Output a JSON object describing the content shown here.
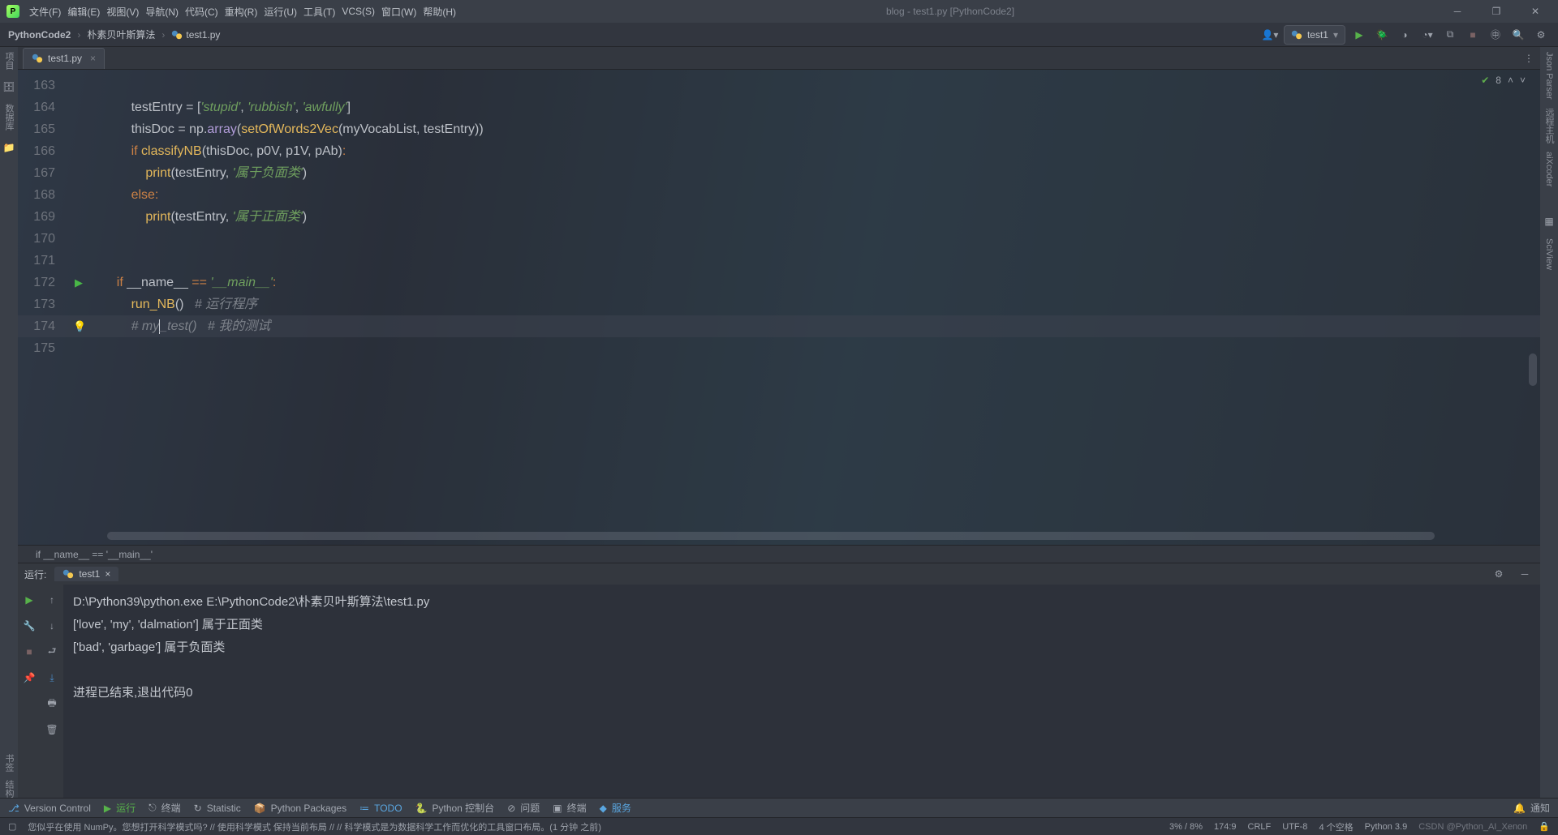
{
  "window_title": "blog - test1.py [PythonCode2]",
  "menubar": [
    "文件(F)",
    "编辑(E)",
    "视图(V)",
    "导航(N)",
    "代码(C)",
    "重构(R)",
    "运行(U)",
    "工具(T)",
    "VCS(S)",
    "窗口(W)",
    "帮助(H)"
  ],
  "breadcrumbs": {
    "project": "PythonCode2",
    "folder": "朴素贝叶斯算法",
    "file": "test1.py"
  },
  "run_selector": "test1",
  "editor_tab": "test1.py",
  "inspection": {
    "count": "8"
  },
  "left_tools": [
    "项目",
    "数据库"
  ],
  "right_tools": [
    "Json Parser",
    "远程主机",
    "aiXcoder",
    "SciView"
  ],
  "left_tools_bottom": [
    "书签",
    "结构"
  ],
  "code": {
    "lines": [
      {
        "n": "163",
        "frag": []
      },
      {
        "n": "164",
        "indent": "        ",
        "frag": [
          {
            "t": "testEntry ",
            "c": "op"
          },
          {
            "t": "= ",
            "c": "op"
          },
          {
            "t": "[",
            "c": "op"
          },
          {
            "t": "'stupid'",
            "c": "str"
          },
          {
            "t": ", ",
            "c": "op"
          },
          {
            "t": "'rubbish'",
            "c": "str"
          },
          {
            "t": ", ",
            "c": "op"
          },
          {
            "t": "'awfully'",
            "c": "str"
          },
          {
            "t": "]",
            "c": "op"
          }
        ]
      },
      {
        "n": "165",
        "indent": "        ",
        "frag": [
          {
            "t": "thisDoc ",
            "c": "op"
          },
          {
            "t": "= ",
            "c": "op"
          },
          {
            "t": "np",
            "c": "op"
          },
          {
            "t": ".",
            "c": "op"
          },
          {
            "t": "array",
            "c": "id"
          },
          {
            "t": "(",
            "c": "op"
          },
          {
            "t": "setOfWords2Vec",
            "c": "fn"
          },
          {
            "t": "(",
            "c": "op"
          },
          {
            "t": "myVocabList",
            "c": "op"
          },
          {
            "t": ", ",
            "c": "op"
          },
          {
            "t": "testEntry",
            "c": "op"
          },
          {
            "t": "))",
            "c": "op"
          }
        ]
      },
      {
        "n": "166",
        "indent": "        ",
        "frag": [
          {
            "t": "if ",
            "c": "kw"
          },
          {
            "t": "classifyNB",
            "c": "fn"
          },
          {
            "t": "(",
            "c": "op"
          },
          {
            "t": "thisDoc",
            "c": "op"
          },
          {
            "t": ", ",
            "c": "op"
          },
          {
            "t": "p0V",
            "c": "op"
          },
          {
            "t": ", ",
            "c": "op"
          },
          {
            "t": "p1V",
            "c": "op"
          },
          {
            "t": ", ",
            "c": "op"
          },
          {
            "t": "pAb",
            "c": "op"
          },
          {
            "t": ")",
            "c": "op"
          },
          {
            "t": ":",
            "c": "kw"
          }
        ]
      },
      {
        "n": "167",
        "indent": "            ",
        "frag": [
          {
            "t": "print",
            "c": "fn"
          },
          {
            "t": "(",
            "c": "op"
          },
          {
            "t": "testEntry",
            "c": "op"
          },
          {
            "t": ", ",
            "c": "op"
          },
          {
            "t": "'属于负面类'",
            "c": "str"
          },
          {
            "t": ")",
            "c": "op"
          }
        ]
      },
      {
        "n": "168",
        "indent": "        ",
        "frag": [
          {
            "t": "else",
            "c": "kw"
          },
          {
            "t": ":",
            "c": "kw"
          }
        ]
      },
      {
        "n": "169",
        "indent": "            ",
        "frag": [
          {
            "t": "print",
            "c": "fn"
          },
          {
            "t": "(",
            "c": "op"
          },
          {
            "t": "testEntry",
            "c": "op"
          },
          {
            "t": ", ",
            "c": "op"
          },
          {
            "t": "'属于正面类'",
            "c": "str"
          },
          {
            "t": ")",
            "c": "op"
          }
        ]
      },
      {
        "n": "170",
        "frag": []
      },
      {
        "n": "171",
        "frag": []
      },
      {
        "n": "172",
        "indent": "    ",
        "run": true,
        "frag": [
          {
            "t": "if ",
            "c": "kw"
          },
          {
            "t": "__name__ ",
            "c": "op"
          },
          {
            "t": "== ",
            "c": "kw"
          },
          {
            "t": "'__main__'",
            "c": "str"
          },
          {
            "t": ":",
            "c": "kw"
          }
        ]
      },
      {
        "n": "173",
        "indent": "        ",
        "frag": [
          {
            "t": "run_NB",
            "c": "fn"
          },
          {
            "t": "()",
            "c": "op"
          },
          {
            "t": "   ",
            "c": "op"
          },
          {
            "t": "# 运行程序",
            "c": "cm"
          }
        ]
      },
      {
        "n": "174",
        "indent": "        ",
        "cur": true,
        "bulb": true,
        "frag": [
          {
            "t": "# my",
            "c": "cm"
          },
          {
            "t": "",
            "caret": true
          },
          {
            "t": "_test()   # 我的测试",
            "c": "cm"
          }
        ]
      },
      {
        "n": "175",
        "frag": []
      }
    ]
  },
  "crumb_bottom": "if __name__ == '__main__'",
  "run_panel": {
    "label": "运行:",
    "tab": "test1"
  },
  "console_lines": [
    "D:\\Python39\\python.exe E:\\PythonCode2\\朴素贝叶斯算法\\test1.py",
    "['love', 'my', 'dalmation'] 属于正面类",
    "['bad', 'garbage'] 属于负面类",
    "",
    "进程已结束,退出代码0"
  ],
  "bottom_items": [
    "Version Control",
    "运行",
    "终端",
    "Statistic",
    "Python Packages",
    "TODO",
    "Python 控制台",
    "问题",
    "终端",
    "服务"
  ],
  "bottom_right": "通知",
  "status": {
    "msg": "您似乎在使用 NumPy。您想打开科学模式吗?  // 使用科学模式  保持当前布局 // // 科学模式是为数据科学工作而优化的工具窗口布局。(1 分钟 之前)",
    "perf": "3% / 8%",
    "pos": "174:9",
    "eol": "CRLF",
    "enc": "UTF-8",
    "indent": "4 个空格",
    "interpreter": "Python 3.9",
    "watermark": "CSDN @Python_AI_Xenon"
  }
}
